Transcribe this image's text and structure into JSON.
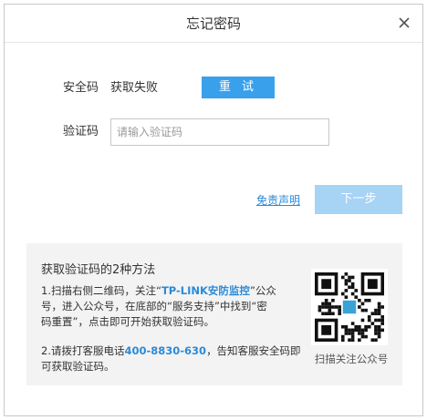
{
  "dialog": {
    "title": "忘记密码",
    "close_icon": "close-icon"
  },
  "security_code": {
    "label": "安全码",
    "status": "获取失败",
    "retry_label": "重 试"
  },
  "captcha": {
    "label": "验证码",
    "value": "",
    "placeholder": "请输入验证码"
  },
  "actions": {
    "disclaimer_label": "免责声明",
    "next_label": "下一步"
  },
  "help": {
    "title": "获取验证码的2种方法",
    "step1": {
      "prefix": "1.扫描右侧二维码，关注“",
      "highlight": "TP-LINK安防监控",
      "line1_suffix": "”公众",
      "line2": "号，进入公众号，在底部的“服务支持”中找到“密",
      "line3": "码重置”，点击即可开始获取验证码。"
    },
    "step2": {
      "prefix": "2.请拨打客服电话",
      "phone": "400-8830-630",
      "line1_suffix": "，告知客服安全码即",
      "line2": "可获取验证码。"
    },
    "qr_caption": "扫描关注公众号",
    "qr_icon": "qr-code-icon"
  },
  "colors": {
    "accent": "#39a0ec",
    "accent_disabled": "#a7d3f5",
    "link": "#2b8bd9",
    "panel_bg": "#f3f3f3",
    "border": "#c8c8c8"
  }
}
